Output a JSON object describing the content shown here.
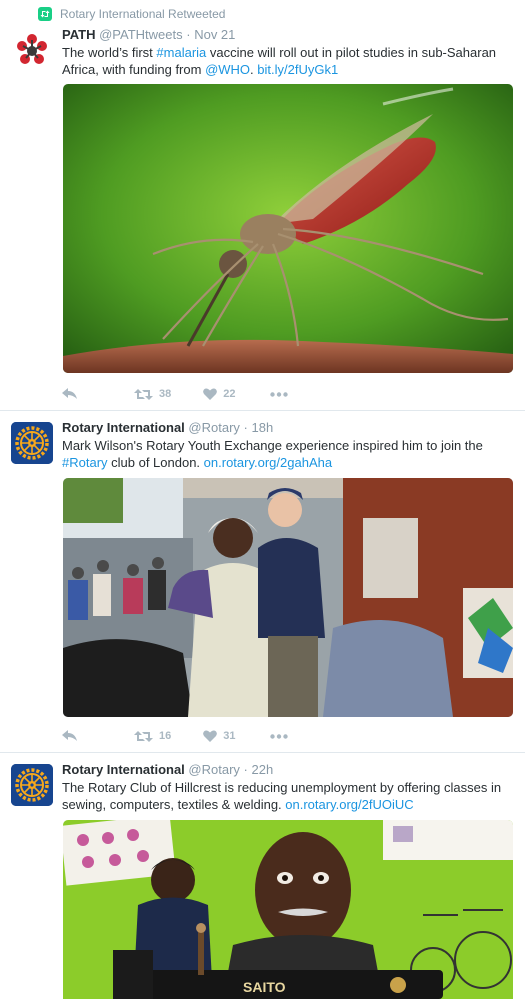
{
  "colors": {
    "link": "#1b95e0",
    "muted": "#8899a6",
    "action": "#aab8c2",
    "retweet_badge": "#19cf86",
    "rotary_blue": "#17458f",
    "rotary_gold": "#f7a81b"
  },
  "retweet_notice": {
    "label": "Rotary International Retweeted",
    "icon": "retweet-icon"
  },
  "tweets": [
    {
      "author": "PATH",
      "handle": "@PATHtweets",
      "dot": "·",
      "time": "Nov 21",
      "text_before": "The world’s first ",
      "hashtag": "#malaria",
      "text_mid": " vaccine will roll out in pilot studies in sub-Saharan Africa, with funding from ",
      "mention": "@WHO",
      "text_after": ". ",
      "url": "bit.ly/2fUyGk1",
      "media": "mosquito-photo",
      "actions": {
        "reply_icon": "reply-icon",
        "retweets": "38",
        "likes": "22",
        "more_icon": "more-icon"
      }
    },
    {
      "author": "Rotary International",
      "handle": "@Rotary",
      "dot": "·",
      "time": "18h",
      "text_before": "Mark Wilson's Rotary Youth Exchange experience inspired him to join the ",
      "hashtag": "#Rotary",
      "text_after": " club of London. ",
      "url": "on.rotary.org/2gahAha",
      "media": "youth-exchange-photo",
      "actions": {
        "reply_icon": "reply-icon",
        "retweets": "16",
        "likes": "31",
        "more_icon": "more-icon"
      }
    },
    {
      "author": "Rotary International",
      "handle": "@Rotary",
      "dot": "·",
      "time": "22h",
      "text_before": "The Rotary Club of Hillcrest is reducing unemployment by offering classes in sewing, computers, textiles & welding. ",
      "url": "on.rotary.org/2fUOiUC",
      "media": "sewing-class-photo",
      "machine_brand": "SAITO"
    }
  ]
}
